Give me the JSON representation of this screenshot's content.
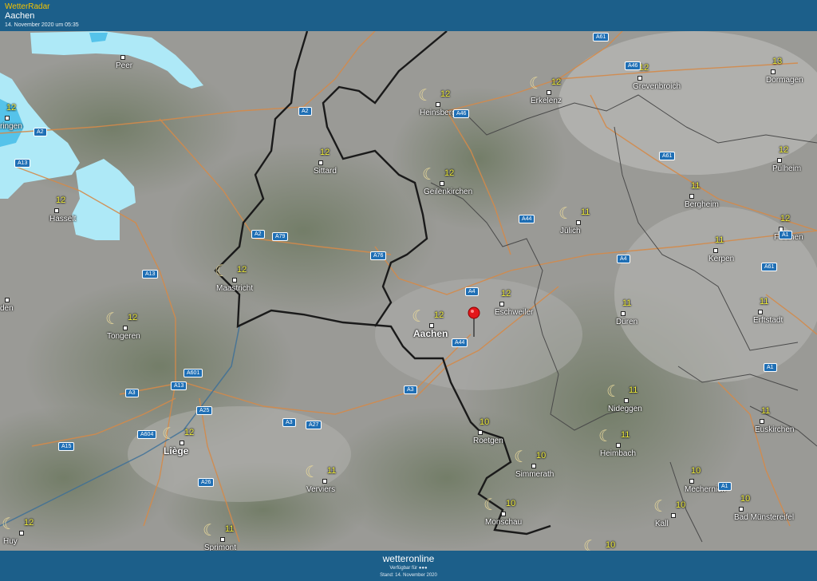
{
  "header": {
    "app_title": "WetterRadar",
    "location": "Aachen",
    "timestamp": "14. November 2020 um 05:35"
  },
  "footer": {
    "brand": "wetteronline",
    "available": "Verfügbar für",
    "stand": "Stand: 14. November 2020"
  },
  "colors": {
    "header_bg": "#1c5f8a",
    "temperature": "#f2ef3e",
    "rain": "#aee9f7",
    "border": "#1a1a1a",
    "roads": "#d48a4a",
    "road_shield": "#1f6fb5"
  },
  "marker": {
    "label": "location-pin"
  },
  "cities": [
    {
      "name": "Peer",
      "temp": "",
      "moon": false
    },
    {
      "name": "ringen",
      "temp": "12",
      "moon": false
    },
    {
      "name": "Hasselt",
      "temp": "12",
      "moon": false
    },
    {
      "name": "Sittard",
      "temp": "12",
      "moon": false
    },
    {
      "name": "Heinsberg",
      "temp": "12",
      "moon": true
    },
    {
      "name": "Erkelenz",
      "temp": "12",
      "moon": true
    },
    {
      "name": "Grevenbroich",
      "temp": "12",
      "moon": false
    },
    {
      "name": "Dormagen",
      "temp": "13",
      "moon": false
    },
    {
      "name": "Pulheim",
      "temp": "12",
      "moon": false
    },
    {
      "name": "Geilenkirchen",
      "temp": "12",
      "moon": true
    },
    {
      "name": "Jülich",
      "temp": "11",
      "moon": true
    },
    {
      "name": "Bergheim",
      "temp": "11",
      "moon": false
    },
    {
      "name": "Frechen",
      "temp": "12",
      "moon": false
    },
    {
      "name": "Kerpen",
      "temp": "11",
      "moon": false
    },
    {
      "name": "Maastricht",
      "temp": "12",
      "moon": true
    },
    {
      "name": "Tongeren",
      "temp": "12",
      "moon": true
    },
    {
      "name": "den",
      "temp": "",
      "moon": false
    },
    {
      "name": "Aachen",
      "temp": "12",
      "moon": true
    },
    {
      "name": "Eschweiler",
      "temp": "12",
      "moon": false
    },
    {
      "name": "Düren",
      "temp": "11",
      "moon": false
    },
    {
      "name": "Erftstadt",
      "temp": "11",
      "moon": false
    },
    {
      "name": "Liège",
      "temp": "12",
      "moon": true
    },
    {
      "name": "Roetgen",
      "temp": "10",
      "moon": false
    },
    {
      "name": "Nideggen",
      "temp": "11",
      "moon": true
    },
    {
      "name": "Euskirchen",
      "temp": "11",
      "moon": false
    },
    {
      "name": "Heimbach",
      "temp": "11",
      "moon": true
    },
    {
      "name": "Verviers",
      "temp": "11",
      "moon": true
    },
    {
      "name": "Simmerath",
      "temp": "10",
      "moon": true
    },
    {
      "name": "Mechernich",
      "temp": "10",
      "moon": false
    },
    {
      "name": "Monschau",
      "temp": "10",
      "moon": true
    },
    {
      "name": "Kall",
      "temp": "10",
      "moon": true
    },
    {
      "name": "Bad Münstereifel",
      "temp": "10",
      "moon": false
    },
    {
      "name": "Huy",
      "temp": "12",
      "moon": true
    },
    {
      "name": "Sprimont",
      "temp": "11",
      "moon": true
    },
    {
      "name": "Hellenthal",
      "temp": "10",
      "moon": true
    }
  ],
  "roads": [
    "A61",
    "A46",
    "A2",
    "A46",
    "A2",
    "A13",
    "A61",
    "A44",
    "A2",
    "A79",
    "A76",
    "A4",
    "A1",
    "A61",
    "A13",
    "A4",
    "A44",
    "A601",
    "A13",
    "A3",
    "A3",
    "A25",
    "A3",
    "A27",
    "A604",
    "A1",
    "A15",
    "A26",
    "A1"
  ]
}
